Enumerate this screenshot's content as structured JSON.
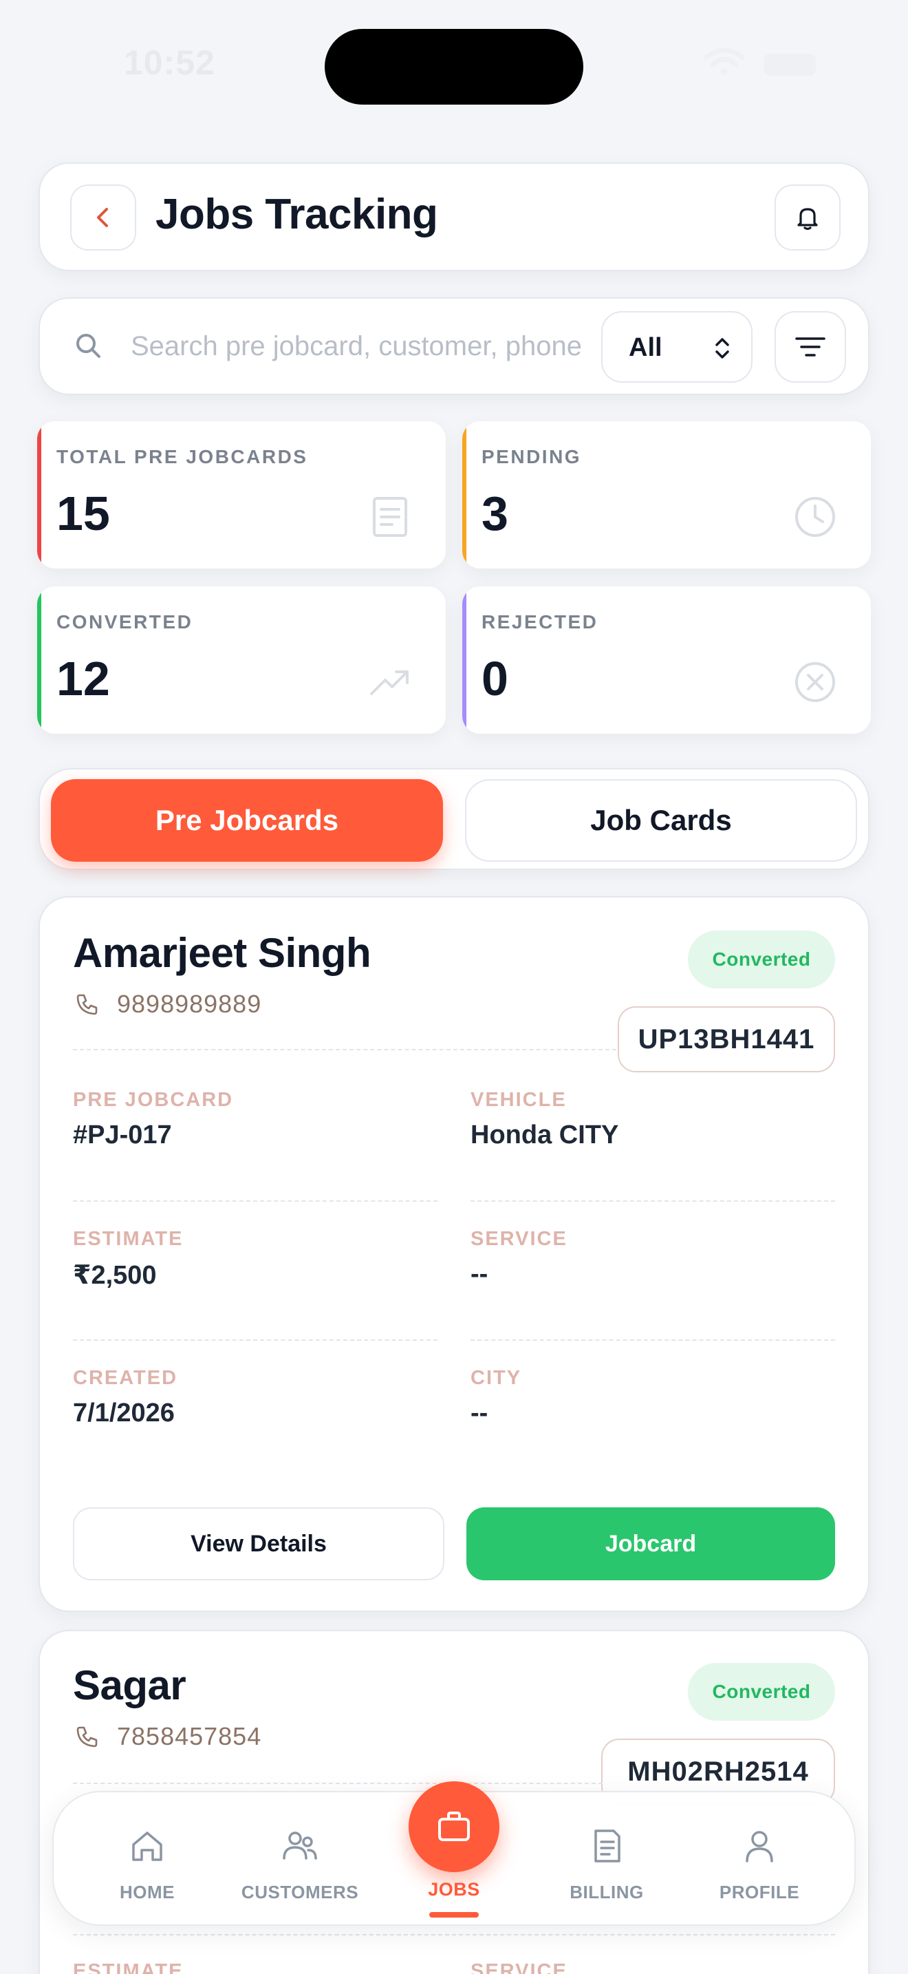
{
  "status_bar": {
    "time": "10:52"
  },
  "header": {
    "title": "Jobs Tracking"
  },
  "search": {
    "placeholder": "Search pre jobcard, customer, phone",
    "value": "",
    "filter_selected": "All"
  },
  "stats": [
    {
      "label": "TOTAL PRE JOBCARDS",
      "value": "15",
      "color": "#ef4444",
      "icon": "document-icon"
    },
    {
      "label": "PENDING",
      "value": "3",
      "color": "#f5a623",
      "icon": "clock-icon"
    },
    {
      "label": "CONVERTED",
      "value": "12",
      "color": "#22c55e",
      "icon": "trending-up-icon"
    },
    {
      "label": "REJECTED",
      "value": "0",
      "color": "#a78bfa",
      "icon": "x-circle-icon"
    }
  ],
  "tabs": [
    {
      "label": "Pre Jobcards",
      "active": true
    },
    {
      "label": "Job Cards",
      "active": false
    }
  ],
  "jobs": [
    {
      "name": "Amarjeet Singh",
      "phone": "9898989889",
      "status": "Converted",
      "plate": "UP13BH1441",
      "fields": {
        "pre_jobcard": {
          "label": "PRE JOBCARD",
          "value": "#PJ-017"
        },
        "vehicle": {
          "label": "VEHICLE",
          "value": "Honda CITY"
        },
        "estimate": {
          "label": "ESTIMATE",
          "value": "₹2,500"
        },
        "service": {
          "label": "SERVICE",
          "value": "--"
        },
        "created": {
          "label": "CREATED",
          "value": "7/1/2026"
        },
        "city": {
          "label": "CITY",
          "value": "--"
        }
      },
      "actions": {
        "view": "View Details",
        "jobcard": "Jobcard"
      }
    },
    {
      "name": "Sagar",
      "phone": "7858457854",
      "status": "Converted",
      "plate": "MH02RH2514",
      "fields": {
        "estimate": {
          "label": "ESTIMATE"
        },
        "service": {
          "label": "SERVICE"
        }
      }
    }
  ],
  "nav": {
    "home": "HOME",
    "customers": "CUSTOMERS",
    "jobs": "JOBS",
    "billing": "BILLING",
    "profile": "PROFILE"
  },
  "colors": {
    "accent": "#ff5a3a",
    "success": "#2ac66d",
    "success_bg": "#e3f7ea",
    "label_muted": "#deb3aa"
  }
}
